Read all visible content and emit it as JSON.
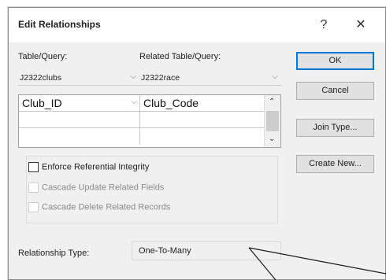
{
  "dialog": {
    "title": "Edit Relationships",
    "help_glyph": "?",
    "close_glyph": "✕"
  },
  "table_query": {
    "label": "Table/Query:",
    "value": "J2322clubs",
    "arrow": "⌵"
  },
  "related_table_query": {
    "label": "Related Table/Query:",
    "value": "J2322race",
    "arrow": "⌵"
  },
  "field_grid": {
    "rows": [
      {
        "left": "Club_ID",
        "right": "Club_Code"
      }
    ],
    "cell_arrow": "⌵",
    "scroll_up": "⌃",
    "scroll_down": "⌄"
  },
  "options": {
    "enforce": {
      "label": "Enforce Referential Integrity",
      "checked": false
    },
    "cascade_update": {
      "label": "Cascade Update Related Fields",
      "checked": false,
      "enabled": false
    },
    "cascade_delete": {
      "label": "Cascade Delete Related Records",
      "checked": false,
      "enabled": false
    }
  },
  "relationship_type": {
    "label": "Relationship Type:",
    "value": "One-To-Many"
  },
  "buttons": {
    "ok": "OK",
    "cancel": "Cancel",
    "join_type": "Join Type...",
    "create_new": "Create New..."
  },
  "colors": {
    "dialog_bg": "#f0f0f0",
    "default_button_border": "#0078d7"
  }
}
